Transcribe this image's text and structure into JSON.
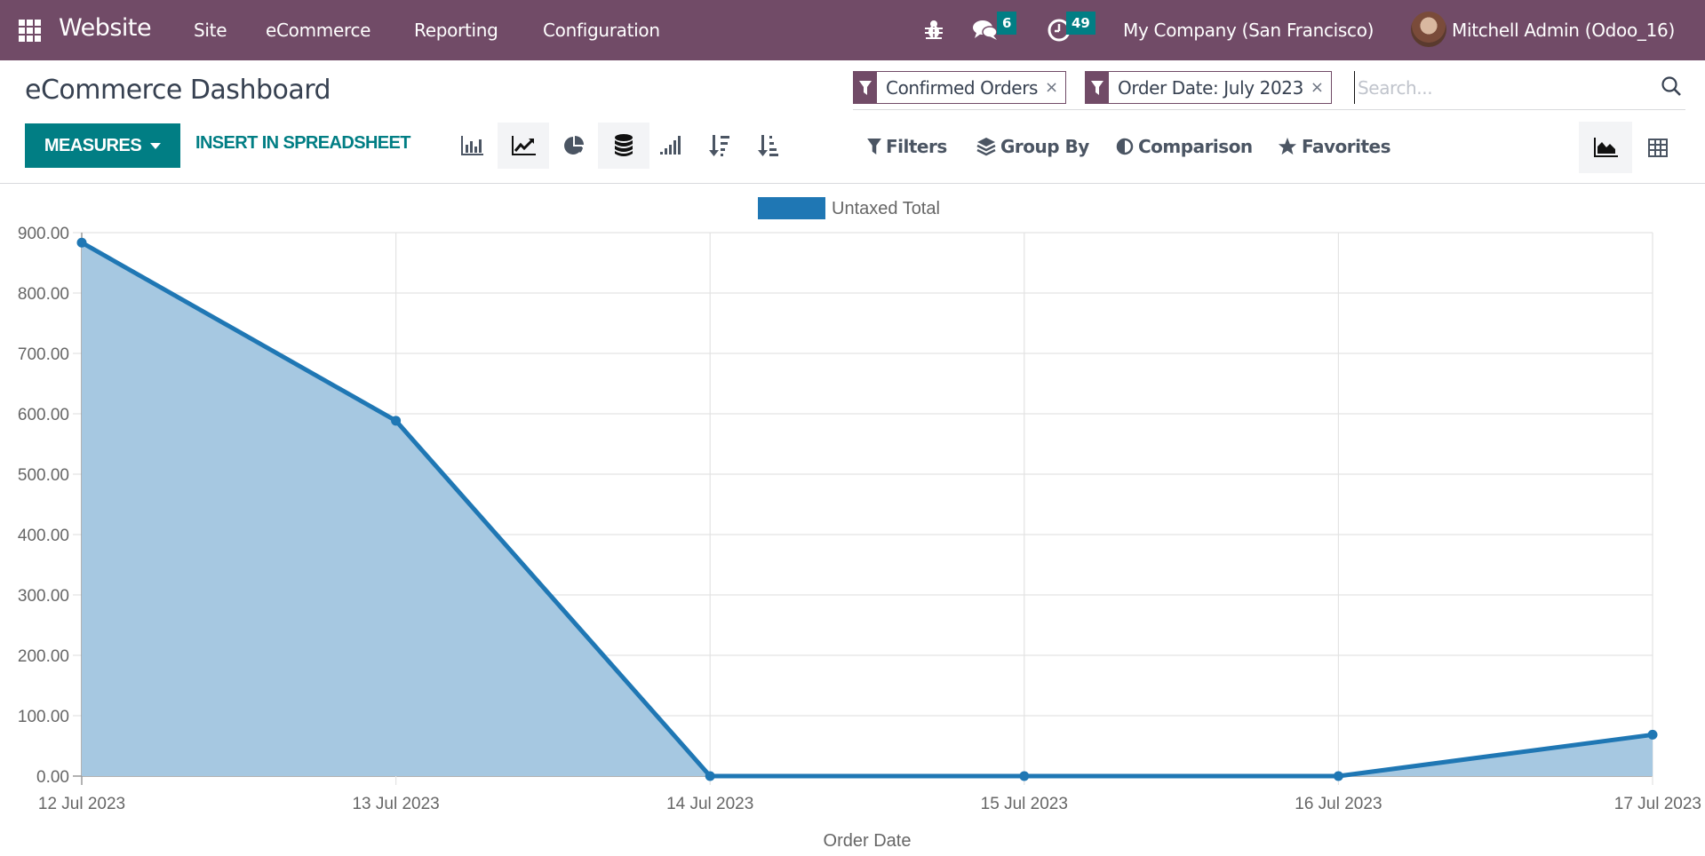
{
  "navbar": {
    "app_name": "Website",
    "menus": [
      "Site",
      "eCommerce",
      "Reporting",
      "Configuration"
    ],
    "messages_count": "6",
    "activities_count": "49",
    "company": "My Company (San Francisco)",
    "user": "Mitchell Admin (Odoo_16)"
  },
  "control_panel": {
    "title": "eCommerce Dashboard",
    "measures_label": "MEASURES",
    "insert_spreadsheet_label": "INSERT IN SPREADSHEET",
    "tools": [
      {
        "name": "bar-chart-icon",
        "active": false
      },
      {
        "name": "line-chart-icon",
        "active": true
      },
      {
        "name": "pie-chart-icon",
        "active": false
      },
      {
        "name": "stacked-icon",
        "active": true
      },
      {
        "name": "cumulative-icon",
        "active": false
      },
      {
        "name": "sort-descending-icon",
        "active": false
      },
      {
        "name": "sort-ascending-icon",
        "active": false
      }
    ],
    "facets": [
      {
        "label": "Confirmed Orders",
        "icon": "filter-icon"
      },
      {
        "label": "Order Date: July 2023",
        "icon": "filter-icon"
      }
    ],
    "search": {
      "value": "",
      "placeholder": "Search..."
    },
    "filters_label": "Filters",
    "group_by_label": "Group By",
    "comparison_label": "Comparison",
    "favorites_label": "Favorites",
    "views": [
      {
        "name": "graph-view",
        "active": true
      },
      {
        "name": "pivot-view",
        "active": false
      }
    ]
  },
  "colors": {
    "navbar": "#714b67",
    "primary": "#017e84",
    "series": "#1f77b4",
    "series_fill": "#a6c8e1"
  },
  "chart_data": {
    "type": "area",
    "title": "",
    "legend": [
      "Untaxed Total"
    ],
    "legend_position": "top-center",
    "xlabel": "Order Date",
    "ylabel": "",
    "categories": [
      "12 Jul 2023",
      "13 Jul 2023",
      "14 Jul 2023",
      "15 Jul 2023",
      "16 Jul 2023",
      "17 Jul 2023"
    ],
    "series": [
      {
        "name": "Untaxed Total",
        "values": [
          883.5,
          588.5,
          0.0,
          0.0,
          0.0,
          68.5
        ]
      }
    ],
    "ylim": [
      0,
      900
    ],
    "yticks": [
      "0.00",
      "100.00",
      "200.00",
      "300.00",
      "400.00",
      "500.00",
      "600.00",
      "700.00",
      "800.00",
      "900.00"
    ],
    "ytick_values": [
      0,
      100,
      200,
      300,
      400,
      500,
      600,
      700,
      800,
      900
    ],
    "grid": true
  }
}
